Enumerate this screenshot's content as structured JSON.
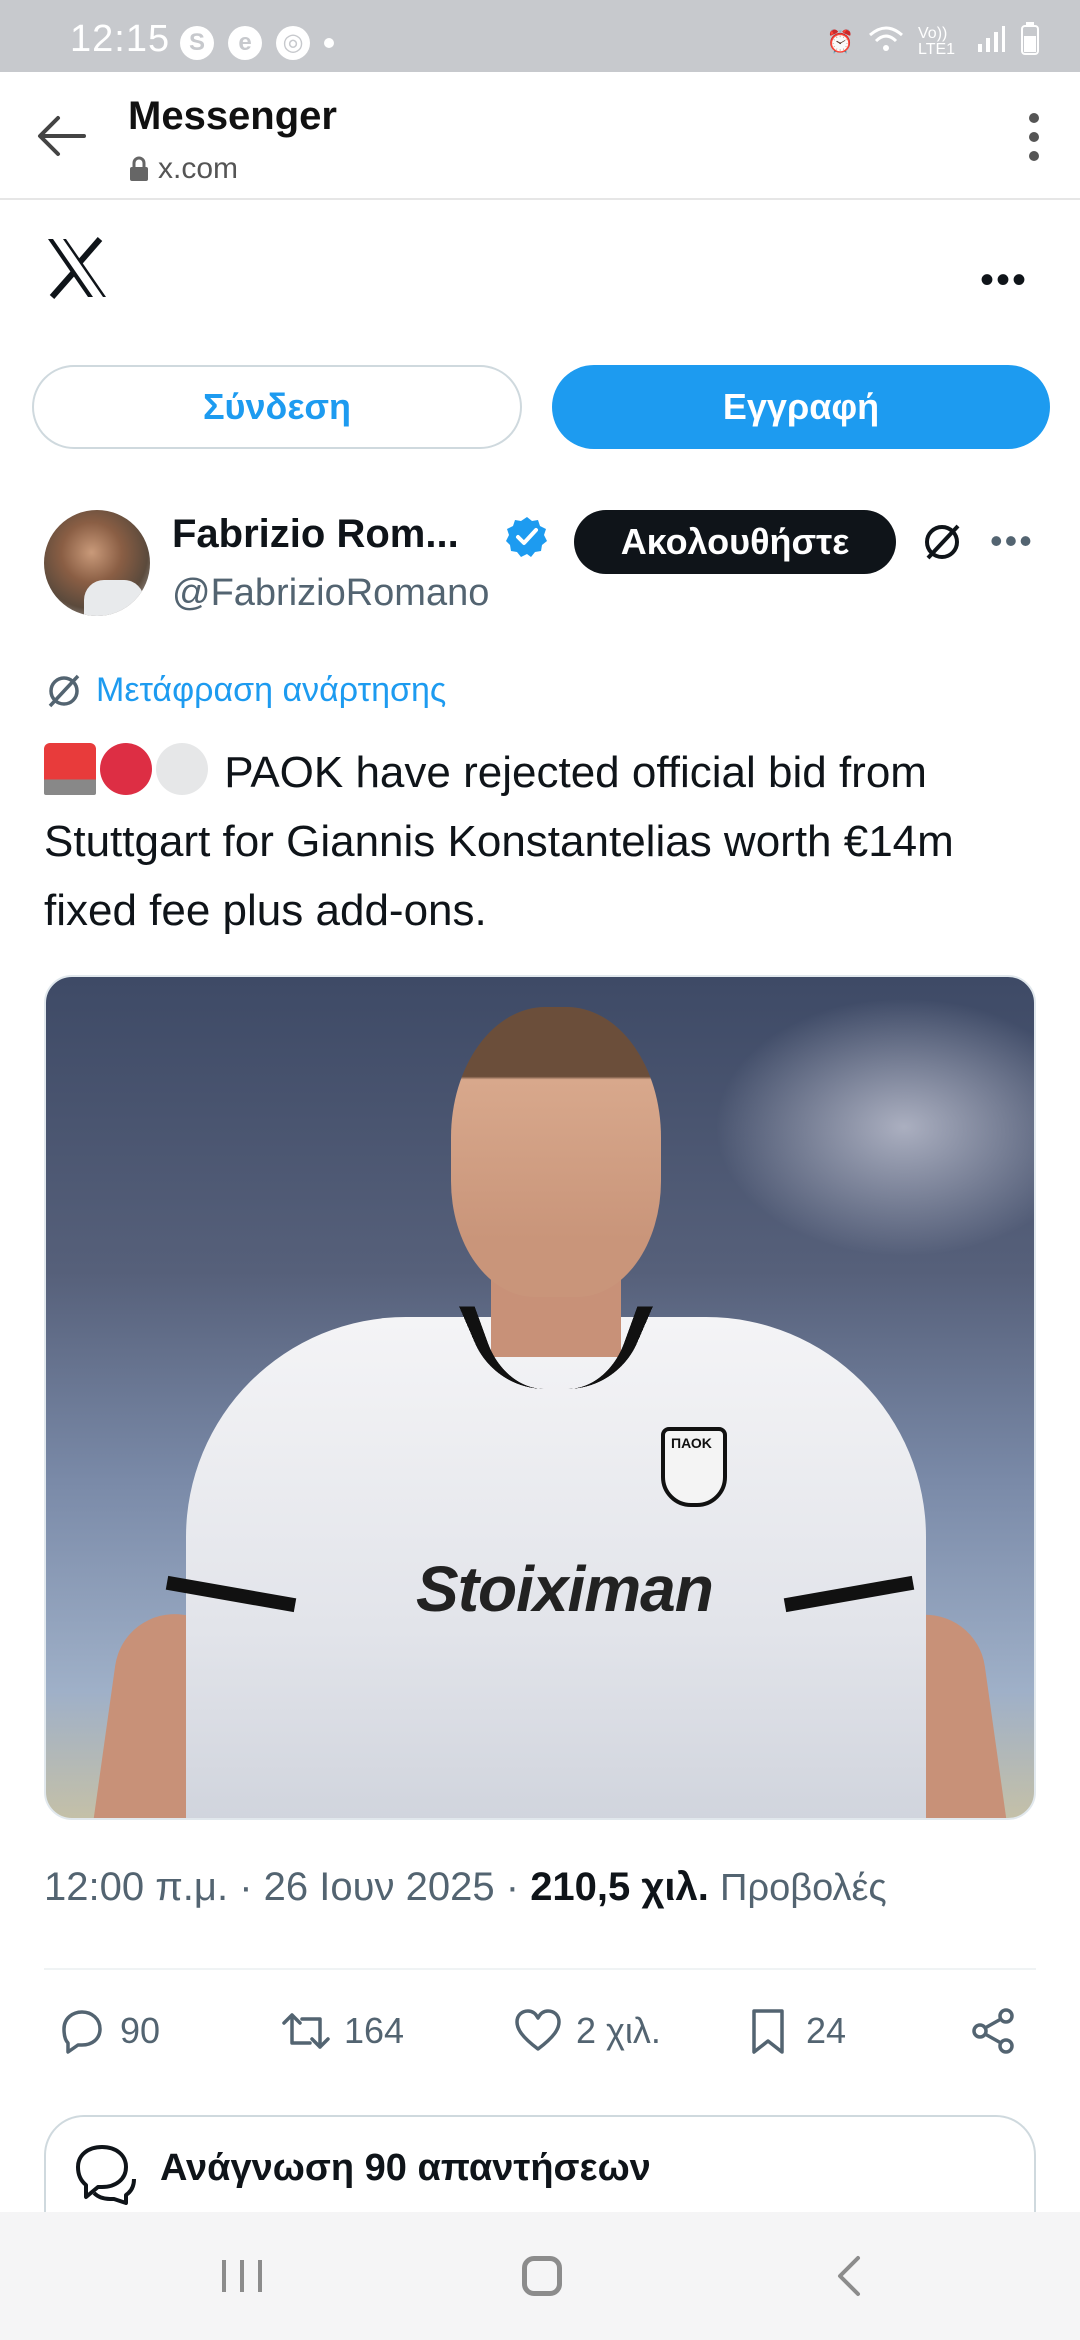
{
  "status_bar": {
    "time": "12:15",
    "notification_icons": [
      "S",
      "e",
      "chrome"
    ],
    "right_icons_text": "Vo)) LTE1"
  },
  "browser": {
    "title": "Messenger",
    "url": "x.com"
  },
  "auth": {
    "login_label": "Σύνδεση",
    "signup_label": "Εγγραφή"
  },
  "post": {
    "author_name": "Fabrizio Rom...",
    "handle": "@FabrizioRomano",
    "follow_label": "Ακολουθήστε",
    "translate_label": "Μετάφραση ανάρτησης",
    "text": "PAOK have rejected official bid from Stuttgart for Giannis Konstantelias worth €14m fixed fee plus add-ons.",
    "image": {
      "sponsor_text": "Stoiximan",
      "crest_text": "ΠΑΟΚ"
    },
    "time": "12:00 π.μ.",
    "date": "26 Ιουν 2025",
    "views": "210,5 χιλ.",
    "views_label": "Προβολές",
    "separator": "·",
    "replies": "90",
    "reposts": "164",
    "likes": "2 χιλ.",
    "bookmarks": "24",
    "read_replies_label": "Ανάγνωση 90 απαντήσεων"
  },
  "colors": {
    "accent": "#1d9bf0",
    "text": "#0f1419",
    "secondary_text": "#536471",
    "status_bar": "#c7c9cd"
  }
}
